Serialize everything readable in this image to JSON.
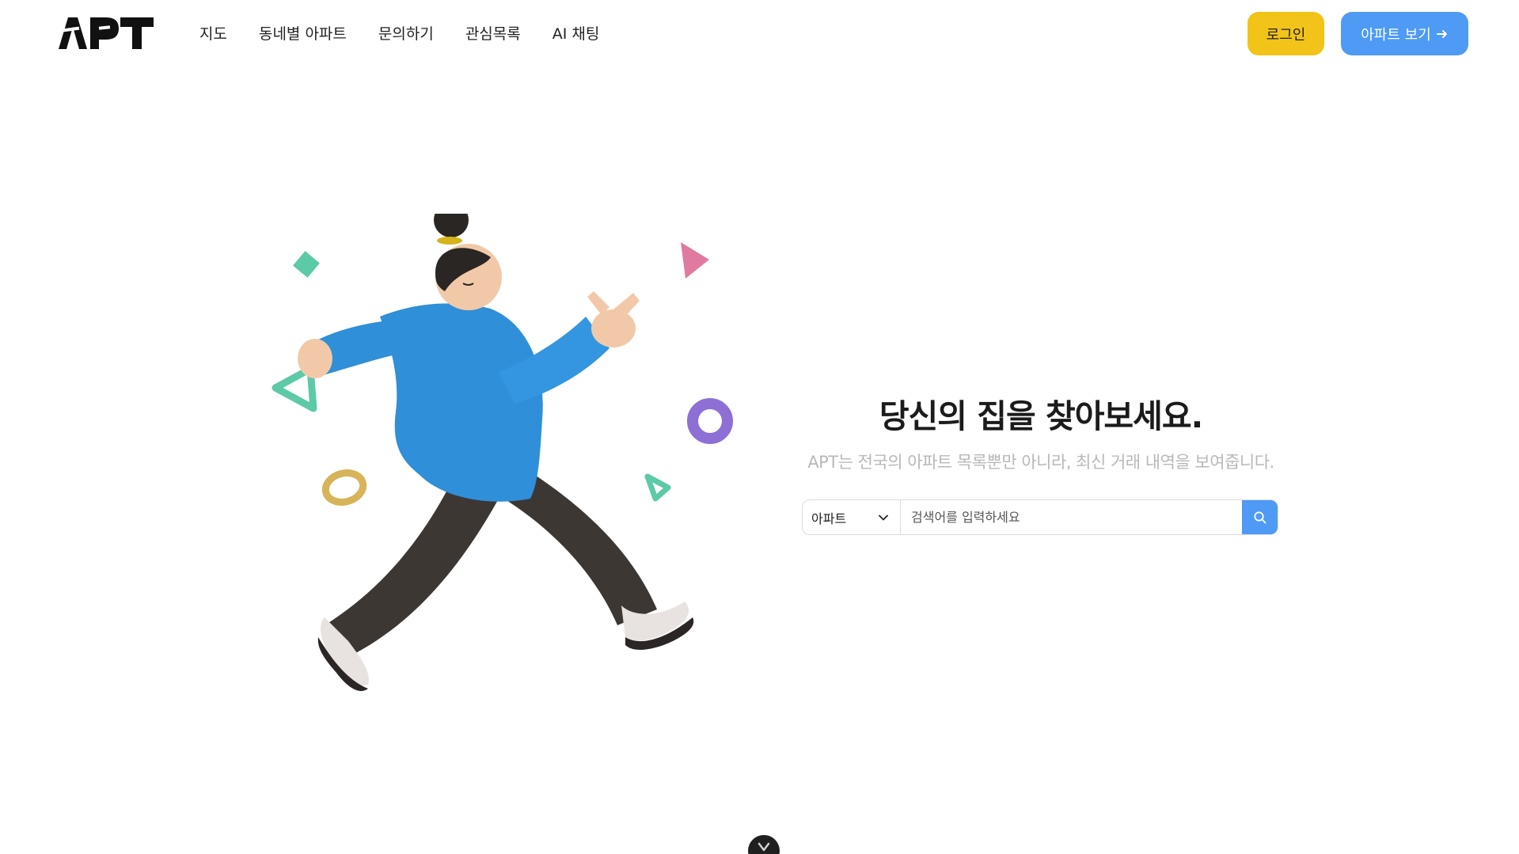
{
  "header": {
    "logo_text": "APT",
    "nav": [
      {
        "label": "지도"
      },
      {
        "label": "동네별 아파트"
      },
      {
        "label": "문의하기"
      },
      {
        "label": "관심목록"
      },
      {
        "label": "AI 채팅"
      }
    ],
    "login_label": "로그인",
    "apt_button_label": "아파트 보기",
    "apt_button_icon": "arrow-right-icon"
  },
  "hero": {
    "title": "당신의 집을 찾아보세요.",
    "subtitle": "APT는 전국의 아파트 목록뿐만 아니라, 최신 거래 내역을 보여줍니다."
  },
  "search": {
    "selected_option": "아파트",
    "placeholder": "검색어를 입력하세요",
    "value": ""
  },
  "colors": {
    "login_button": "#f2c318",
    "accent_blue": "#4e9af5",
    "subtitle_gray": "#b8b8b8"
  },
  "icons": {
    "select": "chevron-down-icon",
    "search": "search-icon",
    "scroll": "chevron-down-icon"
  }
}
